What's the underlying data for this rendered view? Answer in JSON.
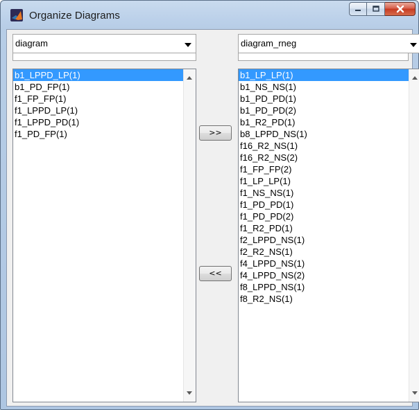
{
  "window": {
    "title": "Organize Diagrams",
    "icon": "matlab-icon",
    "caption_buttons": [
      "minimize-icon",
      "maximize-icon",
      "close-icon"
    ]
  },
  "left_dropdown": {
    "value": "diagram"
  },
  "right_dropdown": {
    "value": "diagram_rneg"
  },
  "left_list": {
    "items": [
      "b1_LPPD_LP(1)",
      "b1_PD_FP(1)",
      "f1_FP_FP(1)",
      "f1_LPPD_LP(1)",
      "f1_LPPD_PD(1)",
      "f1_PD_FP(1)"
    ],
    "selected_index": 0
  },
  "right_list": {
    "items": [
      "b1_LP_LP(1)",
      "b1_NS_NS(1)",
      "b1_PD_PD(1)",
      "b1_PD_PD(2)",
      "b1_R2_PD(1)",
      "b8_LPPD_NS(1)",
      "f16_R2_NS(1)",
      "f16_R2_NS(2)",
      "f1_FP_FP(2)",
      "f1_LP_LP(1)",
      "f1_NS_NS(1)",
      "f1_PD_PD(1)",
      "f1_PD_PD(2)",
      "f1_R2_PD(1)",
      "f2_LPPD_NS(1)",
      "f2_R2_NS(1)",
      "f4_LPPD_NS(1)",
      "f4_LPPD_NS(2)",
      "f8_LPPD_NS(1)",
      "f8_R2_NS(1)"
    ],
    "selected_index": 0
  },
  "buttons": {
    "move_right": ">>",
    "move_left": "<<"
  },
  "colors": {
    "selection": "#3399ff",
    "title_bar": "#bcd1ea",
    "close_button": "#c63a22"
  }
}
